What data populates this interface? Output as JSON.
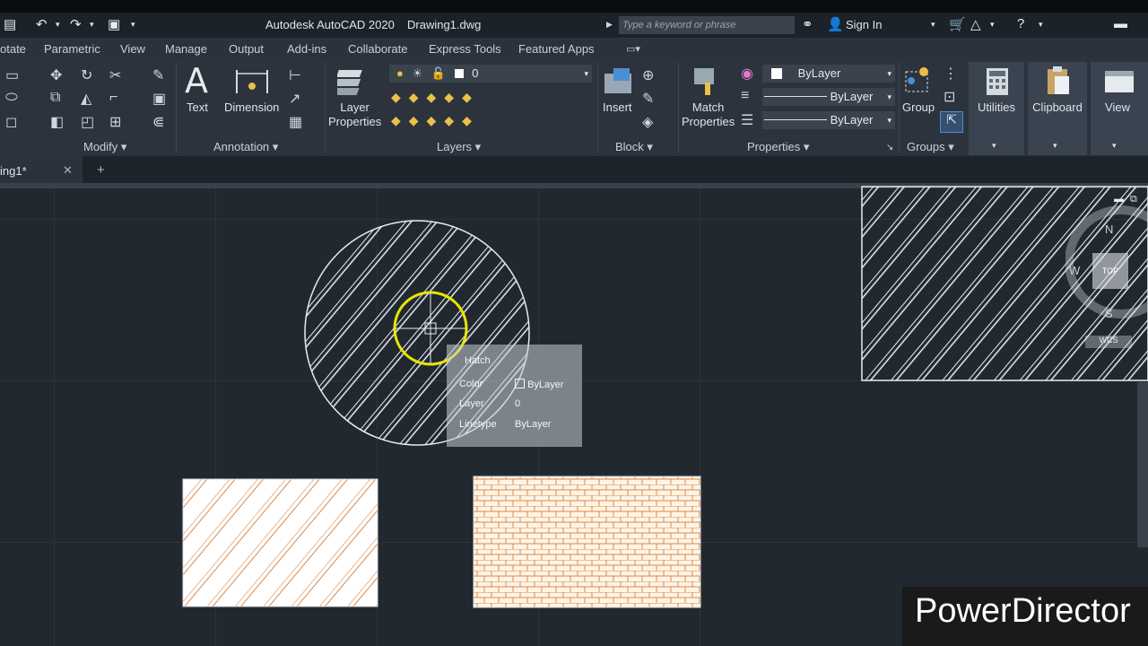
{
  "titlebar": {
    "app_title": "Autodesk AutoCAD 2020",
    "file_name": "Drawing1.dwg",
    "search_placeholder": "Type a keyword or phrase",
    "sign_in": "Sign In"
  },
  "menu_tabs": [
    "otate",
    "Parametric",
    "View",
    "Manage",
    "Output",
    "Add-ins",
    "Collaborate",
    "Express Tools",
    "Featured Apps"
  ],
  "ribbon": {
    "text_label": "Text",
    "dimension_label": "Dimension",
    "layer_properties_label_1": "Layer",
    "layer_properties_label_2": "Properties",
    "layer_value": "0",
    "insert_label": "Insert",
    "match_label_1": "Match",
    "match_label_2": "Properties",
    "color_value": "ByLayer",
    "linetype_value": "ByLayer",
    "lineweight_value": "ByLayer",
    "group_label": "Group",
    "utilities_label": "Utilities",
    "clipboard_label": "Clipboard",
    "view_label": "View",
    "panels": {
      "modify": "Modify",
      "annotation": "Annotation",
      "layers": "Layers",
      "block": "Block",
      "properties": "Properties",
      "groups": "Groups"
    }
  },
  "doc_tab": {
    "name": "ing1*"
  },
  "tooltip": {
    "title": "Hatch",
    "rows": [
      {
        "key": "Color",
        "value": "ByLayer"
      },
      {
        "key": "Layer",
        "value": "0"
      },
      {
        "key": "Linetype",
        "value": "ByLayer"
      }
    ]
  },
  "viewcube": {
    "north": "N",
    "west": "W",
    "south": "S",
    "face": "TOP",
    "wcs": "WCS"
  },
  "watermark": "PowerDirector",
  "colors": {
    "hatch_orange": "#d98a4a",
    "cursor_yellow": "#e6e600",
    "accent": "#3a4350"
  }
}
